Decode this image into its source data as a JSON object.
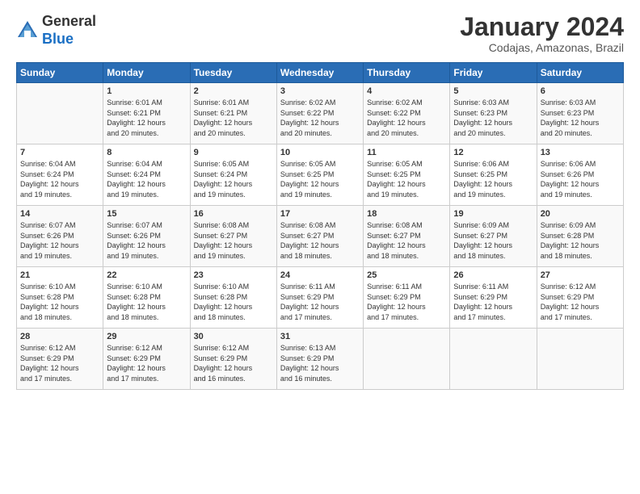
{
  "header": {
    "logo_line1": "General",
    "logo_line2": "Blue",
    "month": "January 2024",
    "location": "Codajas, Amazonas, Brazil"
  },
  "days_of_week": [
    "Sunday",
    "Monday",
    "Tuesday",
    "Wednesday",
    "Thursday",
    "Friday",
    "Saturday"
  ],
  "weeks": [
    [
      {
        "day": "",
        "info": ""
      },
      {
        "day": "1",
        "info": "Sunrise: 6:01 AM\nSunset: 6:21 PM\nDaylight: 12 hours\nand 20 minutes."
      },
      {
        "day": "2",
        "info": "Sunrise: 6:01 AM\nSunset: 6:21 PM\nDaylight: 12 hours\nand 20 minutes."
      },
      {
        "day": "3",
        "info": "Sunrise: 6:02 AM\nSunset: 6:22 PM\nDaylight: 12 hours\nand 20 minutes."
      },
      {
        "day": "4",
        "info": "Sunrise: 6:02 AM\nSunset: 6:22 PM\nDaylight: 12 hours\nand 20 minutes."
      },
      {
        "day": "5",
        "info": "Sunrise: 6:03 AM\nSunset: 6:23 PM\nDaylight: 12 hours\nand 20 minutes."
      },
      {
        "day": "6",
        "info": "Sunrise: 6:03 AM\nSunset: 6:23 PM\nDaylight: 12 hours\nand 20 minutes."
      }
    ],
    [
      {
        "day": "7",
        "info": "Sunrise: 6:04 AM\nSunset: 6:24 PM\nDaylight: 12 hours\nand 19 minutes."
      },
      {
        "day": "8",
        "info": "Sunrise: 6:04 AM\nSunset: 6:24 PM\nDaylight: 12 hours\nand 19 minutes."
      },
      {
        "day": "9",
        "info": "Sunrise: 6:05 AM\nSunset: 6:24 PM\nDaylight: 12 hours\nand 19 minutes."
      },
      {
        "day": "10",
        "info": "Sunrise: 6:05 AM\nSunset: 6:25 PM\nDaylight: 12 hours\nand 19 minutes."
      },
      {
        "day": "11",
        "info": "Sunrise: 6:05 AM\nSunset: 6:25 PM\nDaylight: 12 hours\nand 19 minutes."
      },
      {
        "day": "12",
        "info": "Sunrise: 6:06 AM\nSunset: 6:25 PM\nDaylight: 12 hours\nand 19 minutes."
      },
      {
        "day": "13",
        "info": "Sunrise: 6:06 AM\nSunset: 6:26 PM\nDaylight: 12 hours\nand 19 minutes."
      }
    ],
    [
      {
        "day": "14",
        "info": "Sunrise: 6:07 AM\nSunset: 6:26 PM\nDaylight: 12 hours\nand 19 minutes."
      },
      {
        "day": "15",
        "info": "Sunrise: 6:07 AM\nSunset: 6:26 PM\nDaylight: 12 hours\nand 19 minutes."
      },
      {
        "day": "16",
        "info": "Sunrise: 6:08 AM\nSunset: 6:27 PM\nDaylight: 12 hours\nand 19 minutes."
      },
      {
        "day": "17",
        "info": "Sunrise: 6:08 AM\nSunset: 6:27 PM\nDaylight: 12 hours\nand 18 minutes."
      },
      {
        "day": "18",
        "info": "Sunrise: 6:08 AM\nSunset: 6:27 PM\nDaylight: 12 hours\nand 18 minutes."
      },
      {
        "day": "19",
        "info": "Sunrise: 6:09 AM\nSunset: 6:27 PM\nDaylight: 12 hours\nand 18 minutes."
      },
      {
        "day": "20",
        "info": "Sunrise: 6:09 AM\nSunset: 6:28 PM\nDaylight: 12 hours\nand 18 minutes."
      }
    ],
    [
      {
        "day": "21",
        "info": "Sunrise: 6:10 AM\nSunset: 6:28 PM\nDaylight: 12 hours\nand 18 minutes."
      },
      {
        "day": "22",
        "info": "Sunrise: 6:10 AM\nSunset: 6:28 PM\nDaylight: 12 hours\nand 18 minutes."
      },
      {
        "day": "23",
        "info": "Sunrise: 6:10 AM\nSunset: 6:28 PM\nDaylight: 12 hours\nand 18 minutes."
      },
      {
        "day": "24",
        "info": "Sunrise: 6:11 AM\nSunset: 6:29 PM\nDaylight: 12 hours\nand 17 minutes."
      },
      {
        "day": "25",
        "info": "Sunrise: 6:11 AM\nSunset: 6:29 PM\nDaylight: 12 hours\nand 17 minutes."
      },
      {
        "day": "26",
        "info": "Sunrise: 6:11 AM\nSunset: 6:29 PM\nDaylight: 12 hours\nand 17 minutes."
      },
      {
        "day": "27",
        "info": "Sunrise: 6:12 AM\nSunset: 6:29 PM\nDaylight: 12 hours\nand 17 minutes."
      }
    ],
    [
      {
        "day": "28",
        "info": "Sunrise: 6:12 AM\nSunset: 6:29 PM\nDaylight: 12 hours\nand 17 minutes."
      },
      {
        "day": "29",
        "info": "Sunrise: 6:12 AM\nSunset: 6:29 PM\nDaylight: 12 hours\nand 17 minutes."
      },
      {
        "day": "30",
        "info": "Sunrise: 6:12 AM\nSunset: 6:29 PM\nDaylight: 12 hours\nand 16 minutes."
      },
      {
        "day": "31",
        "info": "Sunrise: 6:13 AM\nSunset: 6:29 PM\nDaylight: 12 hours\nand 16 minutes."
      },
      {
        "day": "",
        "info": ""
      },
      {
        "day": "",
        "info": ""
      },
      {
        "day": "",
        "info": ""
      }
    ]
  ]
}
